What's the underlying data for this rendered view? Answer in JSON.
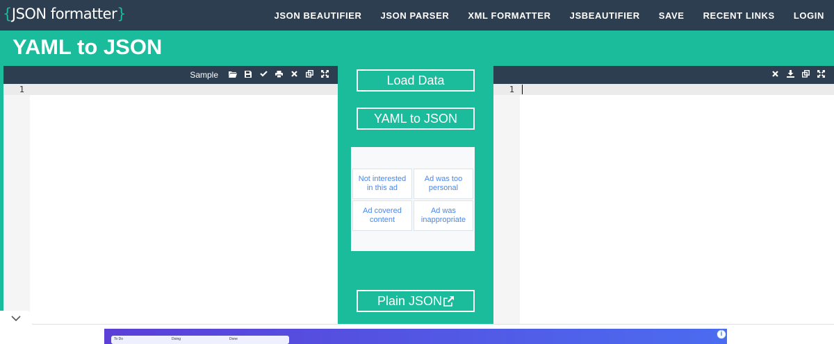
{
  "logo": {
    "open_brace": "{",
    "text": "JSON formatter",
    "close_brace": "}"
  },
  "nav": {
    "items": [
      "JSON BEAUTIFIER",
      "JSON PARSER",
      "XML FORMATTER",
      "JSBEAUTIFIER",
      "SAVE",
      "RECENT LINKS",
      "LOGIN"
    ]
  },
  "page": {
    "title": "YAML to JSON"
  },
  "left_editor": {
    "sample_label": "Sample",
    "line_number": "1",
    "icons": [
      "folder-open-icon",
      "save-icon",
      "check-icon",
      "print-icon",
      "clear-icon",
      "copy-icon",
      "fullscreen-icon"
    ]
  },
  "right_editor": {
    "line_number": "1",
    "icons": [
      "clear-icon",
      "download-icon",
      "copy-icon",
      "fullscreen-icon"
    ]
  },
  "controls": {
    "load_data": "Load Data",
    "convert": "YAML to JSON",
    "plain_json": "Plain JSON"
  },
  "ad_feedback": {
    "options": [
      "Not interested in this ad",
      "Ad was too personal",
      "Ad covered content",
      "Ad was inappropriate"
    ]
  },
  "banner": {
    "columns": [
      "To Do",
      "Doing",
      "Done"
    ],
    "info_icon": "i"
  },
  "colors": {
    "accent": "#1abc9c",
    "dark": "#2c3e50",
    "link": "#4a86e8"
  }
}
